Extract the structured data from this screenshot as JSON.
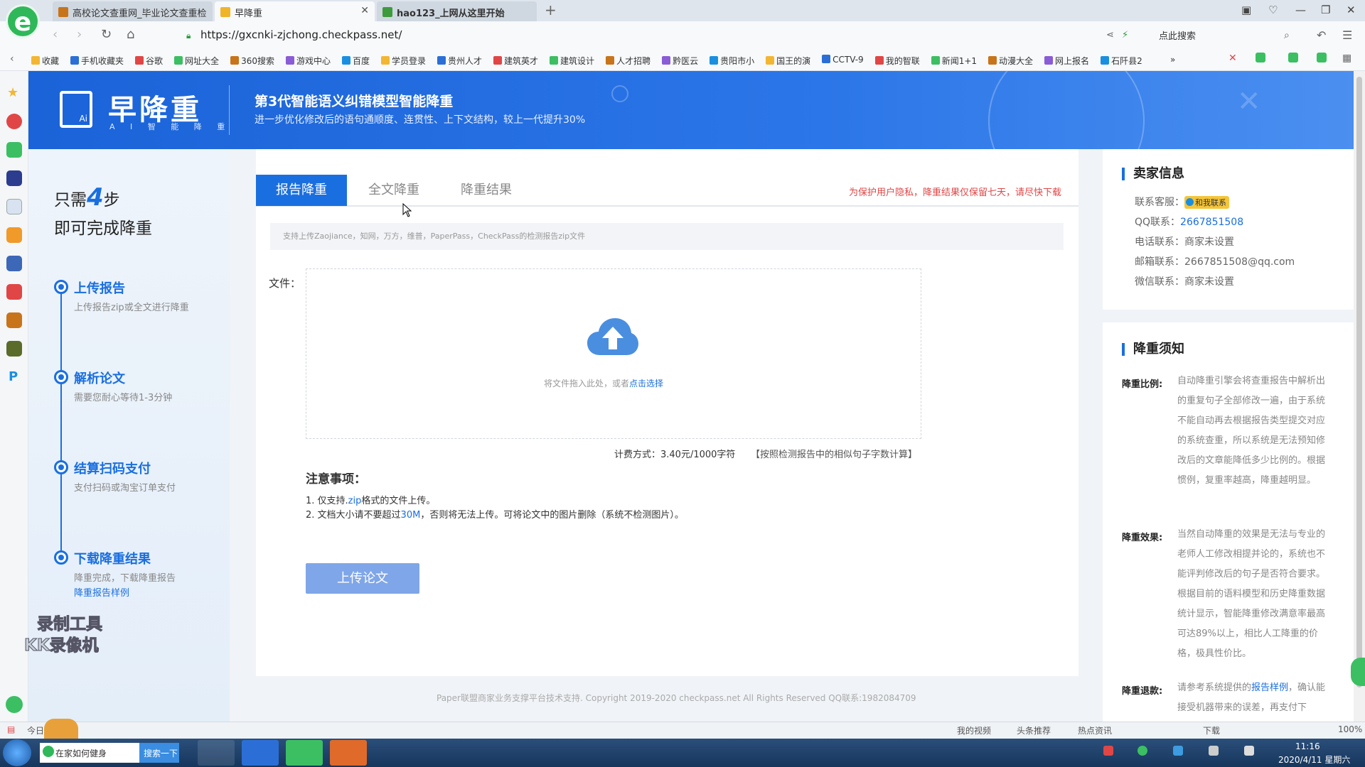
{
  "browser": {
    "tabs": [
      {
        "label": "高校论文查重网_毕业论文查重检",
        "active": false,
        "fav_color": "#c8741a"
      },
      {
        "label": "早降重",
        "active": true,
        "fav_color": "#f0b429"
      },
      {
        "label": "hao123_上网从这里开始",
        "active": false,
        "fav_color": "#3d9b3d"
      }
    ],
    "new_tab": "+",
    "url": "https://gxcnki-zjchong.checkpass.net/",
    "search_placeholder": "点此搜索",
    "bookmarks": [
      "收藏",
      "手机收藏夹",
      "谷歌",
      "网址大全",
      "360搜索",
      "游戏中心",
      "百度",
      "学员登录",
      "贵州人才",
      "建筑英才",
      "建筑设计",
      "人才招聘",
      "黔医云",
      "贵阳市小",
      "国王的演",
      "CCTV-9",
      "我的智联",
      "新闻1+1",
      "动漫大全",
      "网上报名",
      "石阡县2"
    ],
    "bookmark_more": "»"
  },
  "header": {
    "logo_text": "早降重",
    "logo_sub": "A I 智 能 降 重",
    "title": "第3代智能语义纠错模型智能降重",
    "subtitle": "进一步优化修改后的语句通顺度、连贯性、上下文结构，较上一代提升30%"
  },
  "steps": {
    "heading_pre": "只需",
    "heading_num": "4",
    "heading_post": "步",
    "heading2": "即可完成降重",
    "items": [
      {
        "title": "上传报告",
        "desc": "上传报告zip或全文进行降重"
      },
      {
        "title": "解析论文",
        "desc": "需要您耐心等待1-3分钟"
      },
      {
        "title": "结算扫码支付",
        "desc": "支付扫码或淘宝订单支付"
      },
      {
        "title": "下载降重结果",
        "desc": "降重完成，下载降重报告"
      }
    ],
    "sample_link": "降重报告样例",
    "watermark_1": "录制工具",
    "watermark_2": "KK录像机"
  },
  "main": {
    "tabs": [
      "报告降重",
      "全文降重",
      "降重结果"
    ],
    "privacy": "为保护用户隐私，降重结果仅保留七天，请尽快下载",
    "support": "支持上传Zaojiance，知网，万方，维普，PaperPass，CheckPass的检测报告zip文件",
    "file_label": "文件：",
    "drop_text": "将文件拖入此处，或者",
    "drop_link": "点击选择",
    "fee": "计费方式：3.40元/1000字符",
    "fee_note": "【按照检测报告中的相似句子字数计算】",
    "notes_title": "注意事项：",
    "note1_pre": "1. 仅支持.",
    "note1_hl": "zip",
    "note1_post": "格式的文件上传。",
    "note2_pre": "2. 文档大小请不要超过",
    "note2_hl": "30M",
    "note2_post": "，否则将无法上传。可将论文中的图片删除（系统不检测图片）。",
    "upload_button": "上传论文",
    "footer": "Paper联盟商家业务支撑平台技术支持. Copyright 2019-2020 checkpass.net All Rights Reserved QQ联系:1982084709"
  },
  "seller": {
    "title": "卖家信息",
    "cs_label": "联系客服：",
    "cs_badge": "和我联系",
    "qq_label": "QQ联系：",
    "qq_value": "2667851508",
    "phone": "电话联系：商家未设置",
    "email": "邮箱联系：2667851508@qq.com",
    "wechat": "微信联系：商家未设置"
  },
  "notice": {
    "title": "降重须知",
    "ratio_label": "降重比例:",
    "ratio_text": "自动降重引擎会将查重报告中解析出的重复句子全部修改一遍，由于系统不能自动再去根据报告类型提交对应的系统查重，所以系统是无法预知修改后的文章能降低多少比例的。根据惯例，复重率越高，降重越明显。",
    "effect_label": "降重效果:",
    "effect_text": "当然自动降重的效果是无法与专业的老师人工修改相提并论的，系统也不能评判修改后的句子是否符合要求。根据目前的语料模型和历史降重数据统计显示，智能降重修改满意率最高可达89%以上，相比人工降重的价格，极具性价比。",
    "refund_label": "降重退款:",
    "refund_pre": "请参考系统提供的",
    "refund_link": "报告样例",
    "refund_post": "，确认能接受机器带来的误差，再支付下"
  },
  "statusbar": {
    "left": "今日优",
    "items": [
      "我的视频",
      "头条推荐",
      "热点资讯",
      "下载",
      "100%"
    ]
  },
  "taskbar": {
    "search_text": "在家如何健身",
    "search_button": "搜索一下",
    "time": "11:16",
    "date": "2020/4/11 星期六"
  },
  "colors": {
    "accent": "#1a6fe0",
    "warning": "#e04646",
    "button_disabled": "#7fa6e8"
  }
}
